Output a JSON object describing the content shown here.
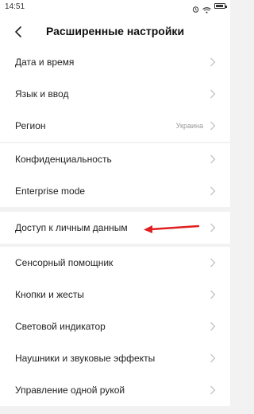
{
  "status_bar": {
    "time": "14:51",
    "icons": [
      "alarm-icon",
      "wifi-icon",
      "battery-icon"
    ]
  },
  "header": {
    "title": "Расширенные настройки",
    "back_icon": "chevron-left-icon"
  },
  "groups": [
    {
      "items": [
        {
          "label": "Дата и время"
        },
        {
          "label": "Язык и ввод"
        },
        {
          "label": "Регион",
          "value": "Украина"
        }
      ]
    },
    {
      "items": [
        {
          "label": "Конфиденциальность"
        },
        {
          "label": "Enterprise mode"
        }
      ]
    },
    {
      "items": [
        {
          "label": "Доступ к личным данным"
        }
      ]
    },
    {
      "items": [
        {
          "label": "Сенсорный помощник"
        },
        {
          "label": "Кнопки и жесты"
        },
        {
          "label": "Световой индикатор"
        },
        {
          "label": "Наушники и звуковые эффекты"
        },
        {
          "label": "Управление одной рукой"
        }
      ]
    }
  ],
  "annotation": {
    "arrow_color": "#e02020",
    "points_to": "Доступ к личным данным"
  },
  "colors": {
    "background": "#f2f2f2",
    "surface": "#ffffff",
    "text": "#222222",
    "secondary_text": "#999999"
  }
}
